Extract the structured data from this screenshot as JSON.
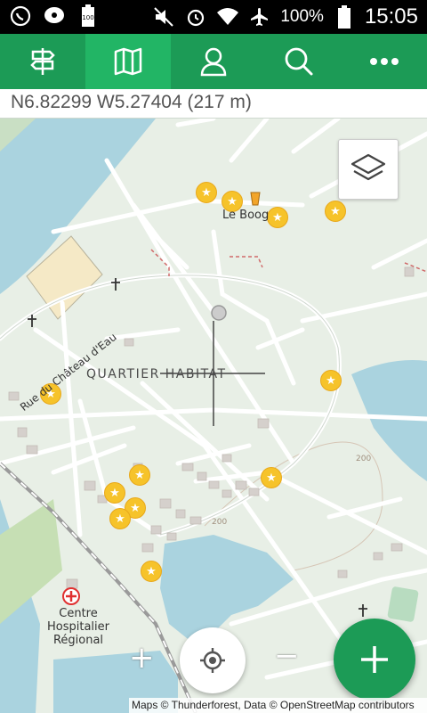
{
  "status_bar": {
    "battery_percent": "100%",
    "time": "15:05",
    "icons": [
      "whatsapp-icon",
      "chat-icon",
      "battery-icon",
      "mute-icon",
      "alarm-icon",
      "wifi-icon",
      "airplane-icon",
      "battery-full-icon"
    ]
  },
  "toolbar": {
    "items": [
      {
        "name": "signpost-icon",
        "active": false
      },
      {
        "name": "map-icon",
        "active": true
      },
      {
        "name": "profile-icon",
        "active": false
      },
      {
        "name": "search-icon",
        "active": false
      },
      {
        "name": "more-icon",
        "active": false
      }
    ],
    "colors": {
      "bar": "#1c9b56",
      "active": "#22b565"
    }
  },
  "coords": {
    "text": "N6.82299 W5.27404 (217 m)"
  },
  "map": {
    "labels": {
      "le_boog": "Le Boog",
      "quartier": "QUARTIER HABITAT",
      "rue": "Rue du Château d'Eau",
      "centre_line1": "Centre",
      "centre_line2": "Hospitalier",
      "centre_line3": "Régional",
      "contour1": "200",
      "contour2": "200"
    },
    "colors": {
      "water": "#aad3df",
      "land": "#e8efe6",
      "poi": "#f6c32a",
      "hospital": "#e03030"
    }
  },
  "controls": {
    "zoom_in": "+",
    "zoom_out": "−",
    "attribution": "Maps © Thunderforest, Data © OpenStreetMap contributors"
  }
}
